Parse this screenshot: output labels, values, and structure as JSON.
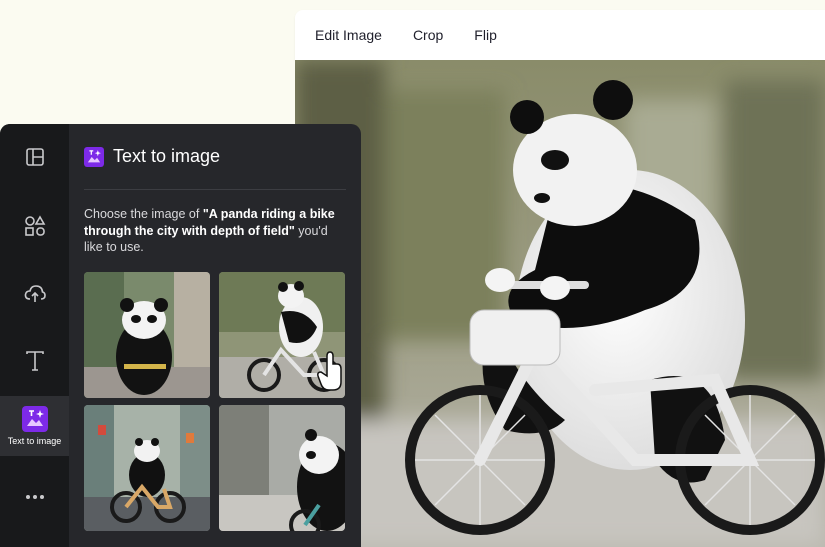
{
  "toolbar": {
    "items": [
      "Edit Image",
      "Crop",
      "Flip"
    ]
  },
  "sidebar": {
    "rail": [
      {
        "icon": "layout-icon"
      },
      {
        "icon": "elements-icon"
      },
      {
        "icon": "upload-icon"
      },
      {
        "icon": "text-icon"
      },
      {
        "icon": "text-to-image-icon",
        "label": "Text to image",
        "active": true
      },
      {
        "icon": "more-icon"
      }
    ]
  },
  "panel": {
    "title": "Text to image",
    "desc_before": "Choose the image of ",
    "prompt": "\"A panda riding a bike through the city with depth of field\"",
    "desc_after": " you'd like to use."
  },
  "results": {
    "count": 4
  },
  "colors": {
    "accent": "#7d2ae8",
    "panel_bg": "#26272b",
    "rail_bg": "#18191b"
  }
}
